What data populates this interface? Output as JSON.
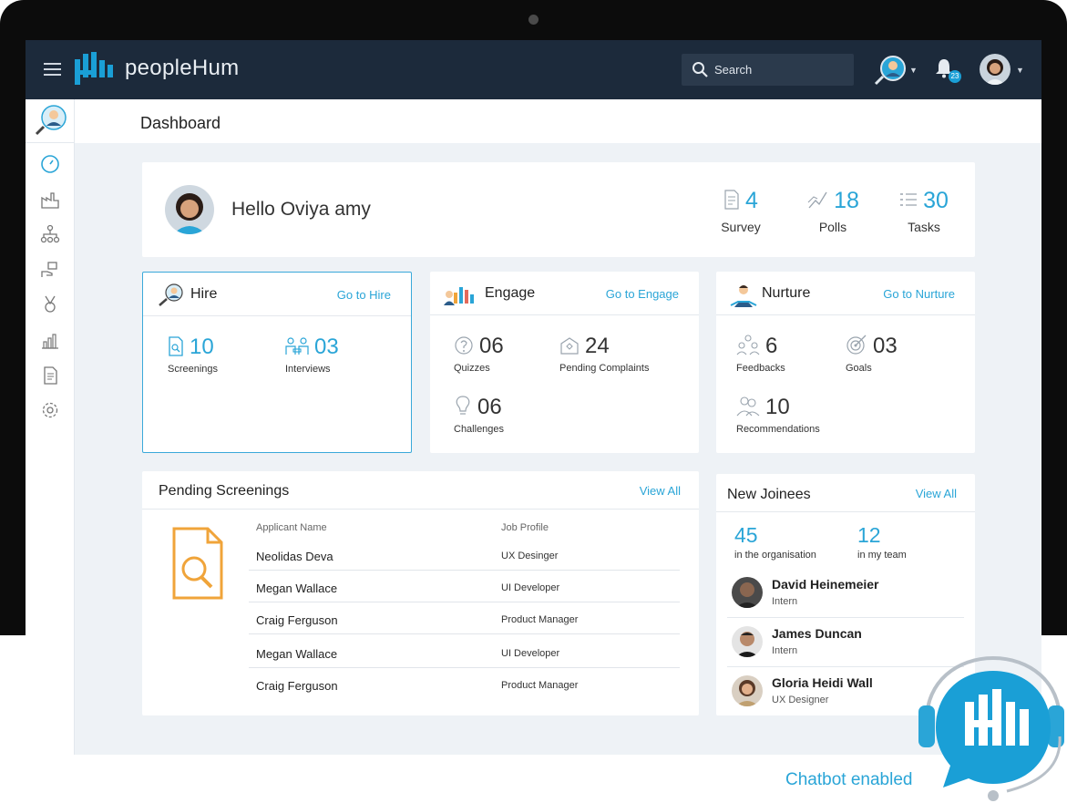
{
  "app": {
    "name": "peopleHum",
    "search_placeholder": "Search",
    "notification_count": "23"
  },
  "page": {
    "title": "Dashboard"
  },
  "greeting": {
    "text": "Hello Oviya amy",
    "stats": [
      {
        "value": "4",
        "label": "Survey"
      },
      {
        "value": "18",
        "label": "Polls"
      },
      {
        "value": "30",
        "label": "Tasks"
      }
    ]
  },
  "hire": {
    "title": "Hire",
    "link": "Go to Hire",
    "metrics": [
      {
        "value": "10",
        "label": "Screenings"
      },
      {
        "value": "03",
        "label": "Interviews"
      }
    ]
  },
  "engage": {
    "title": "Engage",
    "link": "Go to Engage",
    "metrics": [
      {
        "value": "06",
        "label": "Quizzes"
      },
      {
        "value": "24",
        "label": "Pending Complaints"
      },
      {
        "value": "06",
        "label": "Challenges"
      }
    ]
  },
  "nurture": {
    "title": "Nurture",
    "link": "Go to Nurture",
    "metrics": [
      {
        "value": "6",
        "label": "Feedbacks"
      },
      {
        "value": "03",
        "label": "Goals"
      },
      {
        "value": "10",
        "label": "Recommendations"
      }
    ]
  },
  "pending_screenings": {
    "title": "Pending Screenings",
    "view_all": "View All",
    "columns": [
      "Applicant Name",
      "Job Profile"
    ],
    "rows": [
      {
        "name": "Neolidas Deva",
        "job": "UX Desinger"
      },
      {
        "name": "Megan Wallace",
        "job": "UI Developer"
      },
      {
        "name": "Craig Ferguson",
        "job": "Product Manager"
      },
      {
        "name": "Megan Wallace",
        "job": "UI Developer"
      },
      {
        "name": "Craig Ferguson",
        "job": "Product Manager"
      }
    ]
  },
  "new_joinees": {
    "title": "New Joinees",
    "view_all": "View All",
    "stats": [
      {
        "value": "45",
        "label": "in the organisation"
      },
      {
        "value": "12",
        "label": "in my team"
      }
    ],
    "people": [
      {
        "name": "David Heinemeier",
        "role": "Intern"
      },
      {
        "name": "James Duncan",
        "role": "Intern"
      },
      {
        "name": "Gloria Heidi Wall",
        "role": "UX Designer"
      }
    ]
  },
  "chatbot": {
    "label": "Chatbot enabled"
  },
  "colors": {
    "accent": "#2aa5d7",
    "topbar": "#1c2a3b",
    "doc_icon": "#f0a43a"
  }
}
